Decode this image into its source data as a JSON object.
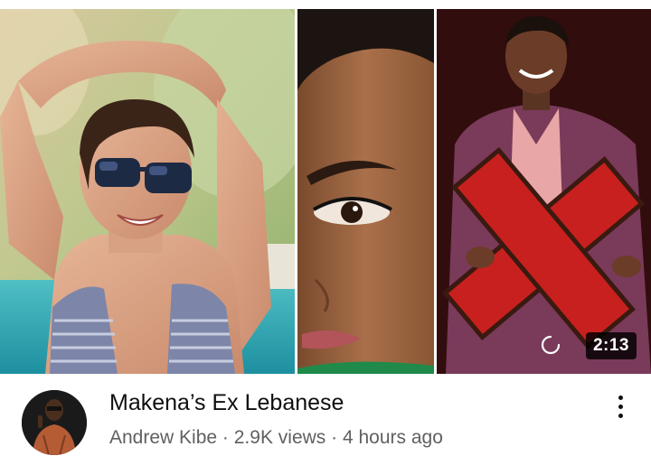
{
  "video": {
    "title": "Makena’s Ex Lebanese",
    "channel": "Andrew Kibe",
    "views": "2.9K views",
    "age": "4 hours ago",
    "separator": " · ",
    "duration": "2:13"
  },
  "thumbnail": {
    "panels": [
      "woman-in-sunglasses-pool-photo",
      "woman-face-closeup-photo",
      "person-holding-red-x-photo"
    ]
  },
  "icons": {
    "more": "more-vertical-icon",
    "loading": "loading-spinner-icon"
  },
  "colors": {
    "title": "#0f0f0f",
    "meta": "#606060",
    "duration_bg": "#000000",
    "accent_red": "#d22a2a"
  }
}
